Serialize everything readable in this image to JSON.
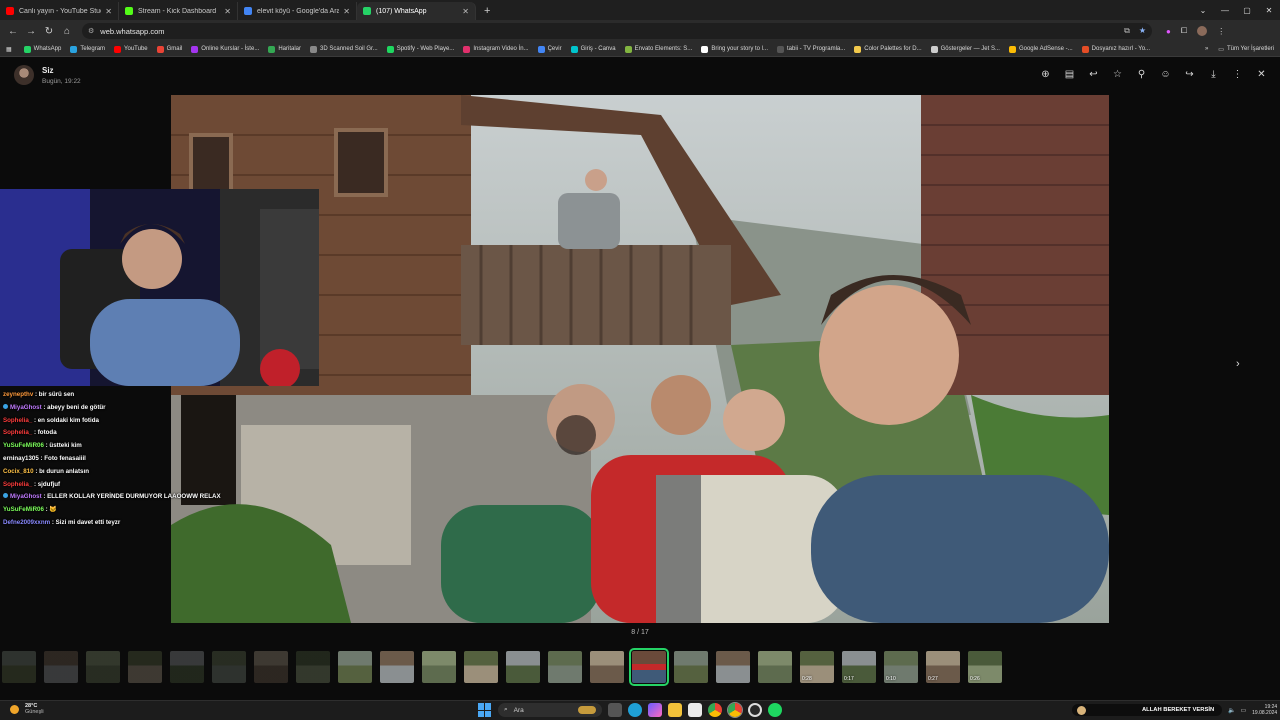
{
  "browser": {
    "tabs": [
      {
        "title": "Canlı yayın - YouTube Studio",
        "color": "#ff0000",
        "active": false
      },
      {
        "title": "Stream - Kick Dashboard",
        "color": "#53fc18",
        "active": false
      },
      {
        "title": "elevit köyü - Google'da Ara",
        "color": "#4285f4",
        "active": false
      },
      {
        "title": "(107) WhatsApp",
        "color": "#25d366",
        "active": true
      }
    ],
    "new_tab_label": "+",
    "url": "web.whatsapp.com",
    "bookmarks": [
      {
        "label": "WhatsApp",
        "color": "#25d366"
      },
      {
        "label": "Telegram",
        "color": "#2aa3e0"
      },
      {
        "label": "YouTube",
        "color": "#ff0000"
      },
      {
        "label": "Gmail",
        "color": "#ea4335"
      },
      {
        "label": "Online Kurslar - İste...",
        "color": "#a435f0"
      },
      {
        "label": "Haritalar",
        "color": "#34a853"
      },
      {
        "label": "3D Scanned Soil Gr...",
        "color": "#888888"
      },
      {
        "label": "Spotify - Web Playe...",
        "color": "#1ed760"
      },
      {
        "label": "Instagram Video İn...",
        "color": "#e1306c"
      },
      {
        "label": "Çevir",
        "color": "#4285f4"
      },
      {
        "label": "Giriş - Canva",
        "color": "#00c4cc"
      },
      {
        "label": "Envato Elements: S...",
        "color": "#82b541"
      },
      {
        "label": "Bring your story to l...",
        "color": "#ffffff"
      },
      {
        "label": "tabii - TV Programla...",
        "color": "#555555"
      },
      {
        "label": "Color Palettes for D...",
        "color": "#f2c94c"
      },
      {
        "label": "Göstergeler — Jet S...",
        "color": "#cccccc"
      },
      {
        "label": "Google AdSense -...",
        "color": "#fbbc05"
      },
      {
        "label": "Dosyanız hazırl - Yo...",
        "color": "#e44d26"
      }
    ],
    "bookmarks_more": "»",
    "all_bookmarks": "Tüm Yer İşaretleri"
  },
  "viewer": {
    "sender_name": "Siz",
    "sender_time": "Bugün, 19:22",
    "counter": "8 / 17",
    "thumbnails": [
      {
        "dim": true,
        "dur": ""
      },
      {
        "dim": true,
        "dur": ""
      },
      {
        "dim": true,
        "dur": ""
      },
      {
        "dim": true,
        "dur": ""
      },
      {
        "dim": true,
        "dur": ""
      },
      {
        "dim": true,
        "dur": ""
      },
      {
        "dim": true,
        "dur": ""
      },
      {
        "dim": true,
        "dur": ""
      },
      {
        "dim": false,
        "dur": ""
      },
      {
        "dim": false,
        "dur": ""
      },
      {
        "dim": false,
        "dur": ""
      },
      {
        "dim": false,
        "dur": ""
      },
      {
        "dim": false,
        "dur": ""
      },
      {
        "dim": false,
        "dur": ""
      },
      {
        "dim": false,
        "dur": ""
      },
      {
        "dim": false,
        "dur": "",
        "selected": true
      },
      {
        "dim": false,
        "dur": ""
      },
      {
        "dim": false,
        "dur": ""
      },
      {
        "dim": false,
        "dur": ""
      },
      {
        "dim": false,
        "dur": "0:28"
      },
      {
        "dim": false,
        "dur": "0:17"
      },
      {
        "dim": false,
        "dur": "0:10"
      },
      {
        "dim": false,
        "dur": "0:27"
      },
      {
        "dim": false,
        "dur": "0:26"
      }
    ]
  },
  "chat": [
    {
      "user": "zeynepthv",
      "color": "#ff9b3d",
      "msg": "bir sürü sen",
      "badge": false
    },
    {
      "user": "MiyaGhost",
      "color": "#c07bff",
      "msg": "abeyy beni de götür",
      "badge": true
    },
    {
      "user": "Sophelia_",
      "color": "#ff3d3d",
      "msg": "en soldaki kim fotida",
      "badge": false
    },
    {
      "user": "Sophelia_",
      "color": "#ff3d3d",
      "msg": "fotoda",
      "badge": false
    },
    {
      "user": "YuSuFeMiR06",
      "color": "#7dff5c",
      "msg": "üstteki kim",
      "badge": false
    },
    {
      "user": "erninay1305",
      "color": "#ffffff",
      "msg": "Foto fenasaiiil",
      "badge": false
    },
    {
      "user": "Cocix_810",
      "color": "#ffc247",
      "msg": "bı durun anlatsın",
      "badge": false
    },
    {
      "user": "Sophelia_",
      "color": "#ff3d3d",
      "msg": "sjdufjuf",
      "badge": false
    },
    {
      "user": "MiyaGhost",
      "color": "#c07bff",
      "msg": "ELLER KOLLAR YERİNDE DURMUYOR LAAOOWW RELAX",
      "badge": true
    },
    {
      "user": "YuSuFeMiR06",
      "color": "#7dff5c",
      "msg": "🐱",
      "badge": false
    },
    {
      "user": "Defne2009xxnm",
      "color": "#8a8aff",
      "msg": "Sizi mi davet etti teyzr",
      "badge": false
    }
  ],
  "taskbar": {
    "temp": "28°C",
    "weather": "Güneşli",
    "search_placeholder": "Ara",
    "ticker": "ALLAH BEREKET VERSİN",
    "time": "19:24",
    "date": "19.08.2024"
  }
}
